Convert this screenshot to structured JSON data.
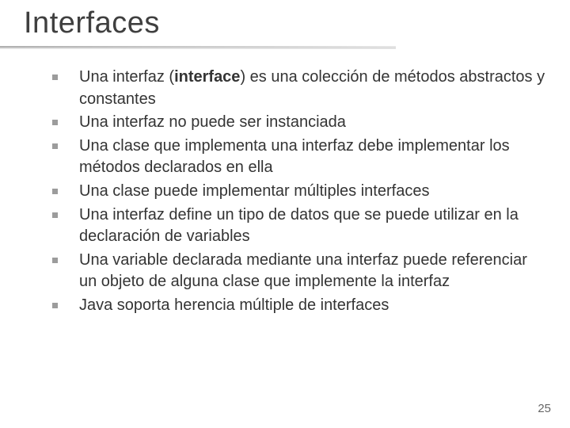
{
  "title": "Interfaces",
  "page_number": "25",
  "bullets": [
    {
      "pre": "Una interfaz (",
      "keyword": "interface",
      "post": ") es una colección de métodos abstractos y constantes"
    },
    {
      "pre": "Una interfaz no puede ser instanciada",
      "keyword": "",
      "post": ""
    },
    {
      "pre": "Una clase que implementa una interfaz debe implementar los métodos declarados en ella",
      "keyword": "",
      "post": ""
    },
    {
      "pre": "Una clase puede implementar múltiples interfaces",
      "keyword": "",
      "post": ""
    },
    {
      "pre": "Una interfaz define un tipo de datos que se puede utilizar en la declaración de variables",
      "keyword": "",
      "post": ""
    },
    {
      "pre": "Una variable declarada mediante una interfaz puede referenciar un objeto de alguna clase que implemente la interfaz",
      "keyword": "",
      "post": ""
    },
    {
      "pre": "Java soporta herencia múltiple de interfaces",
      "keyword": "",
      "post": ""
    }
  ]
}
